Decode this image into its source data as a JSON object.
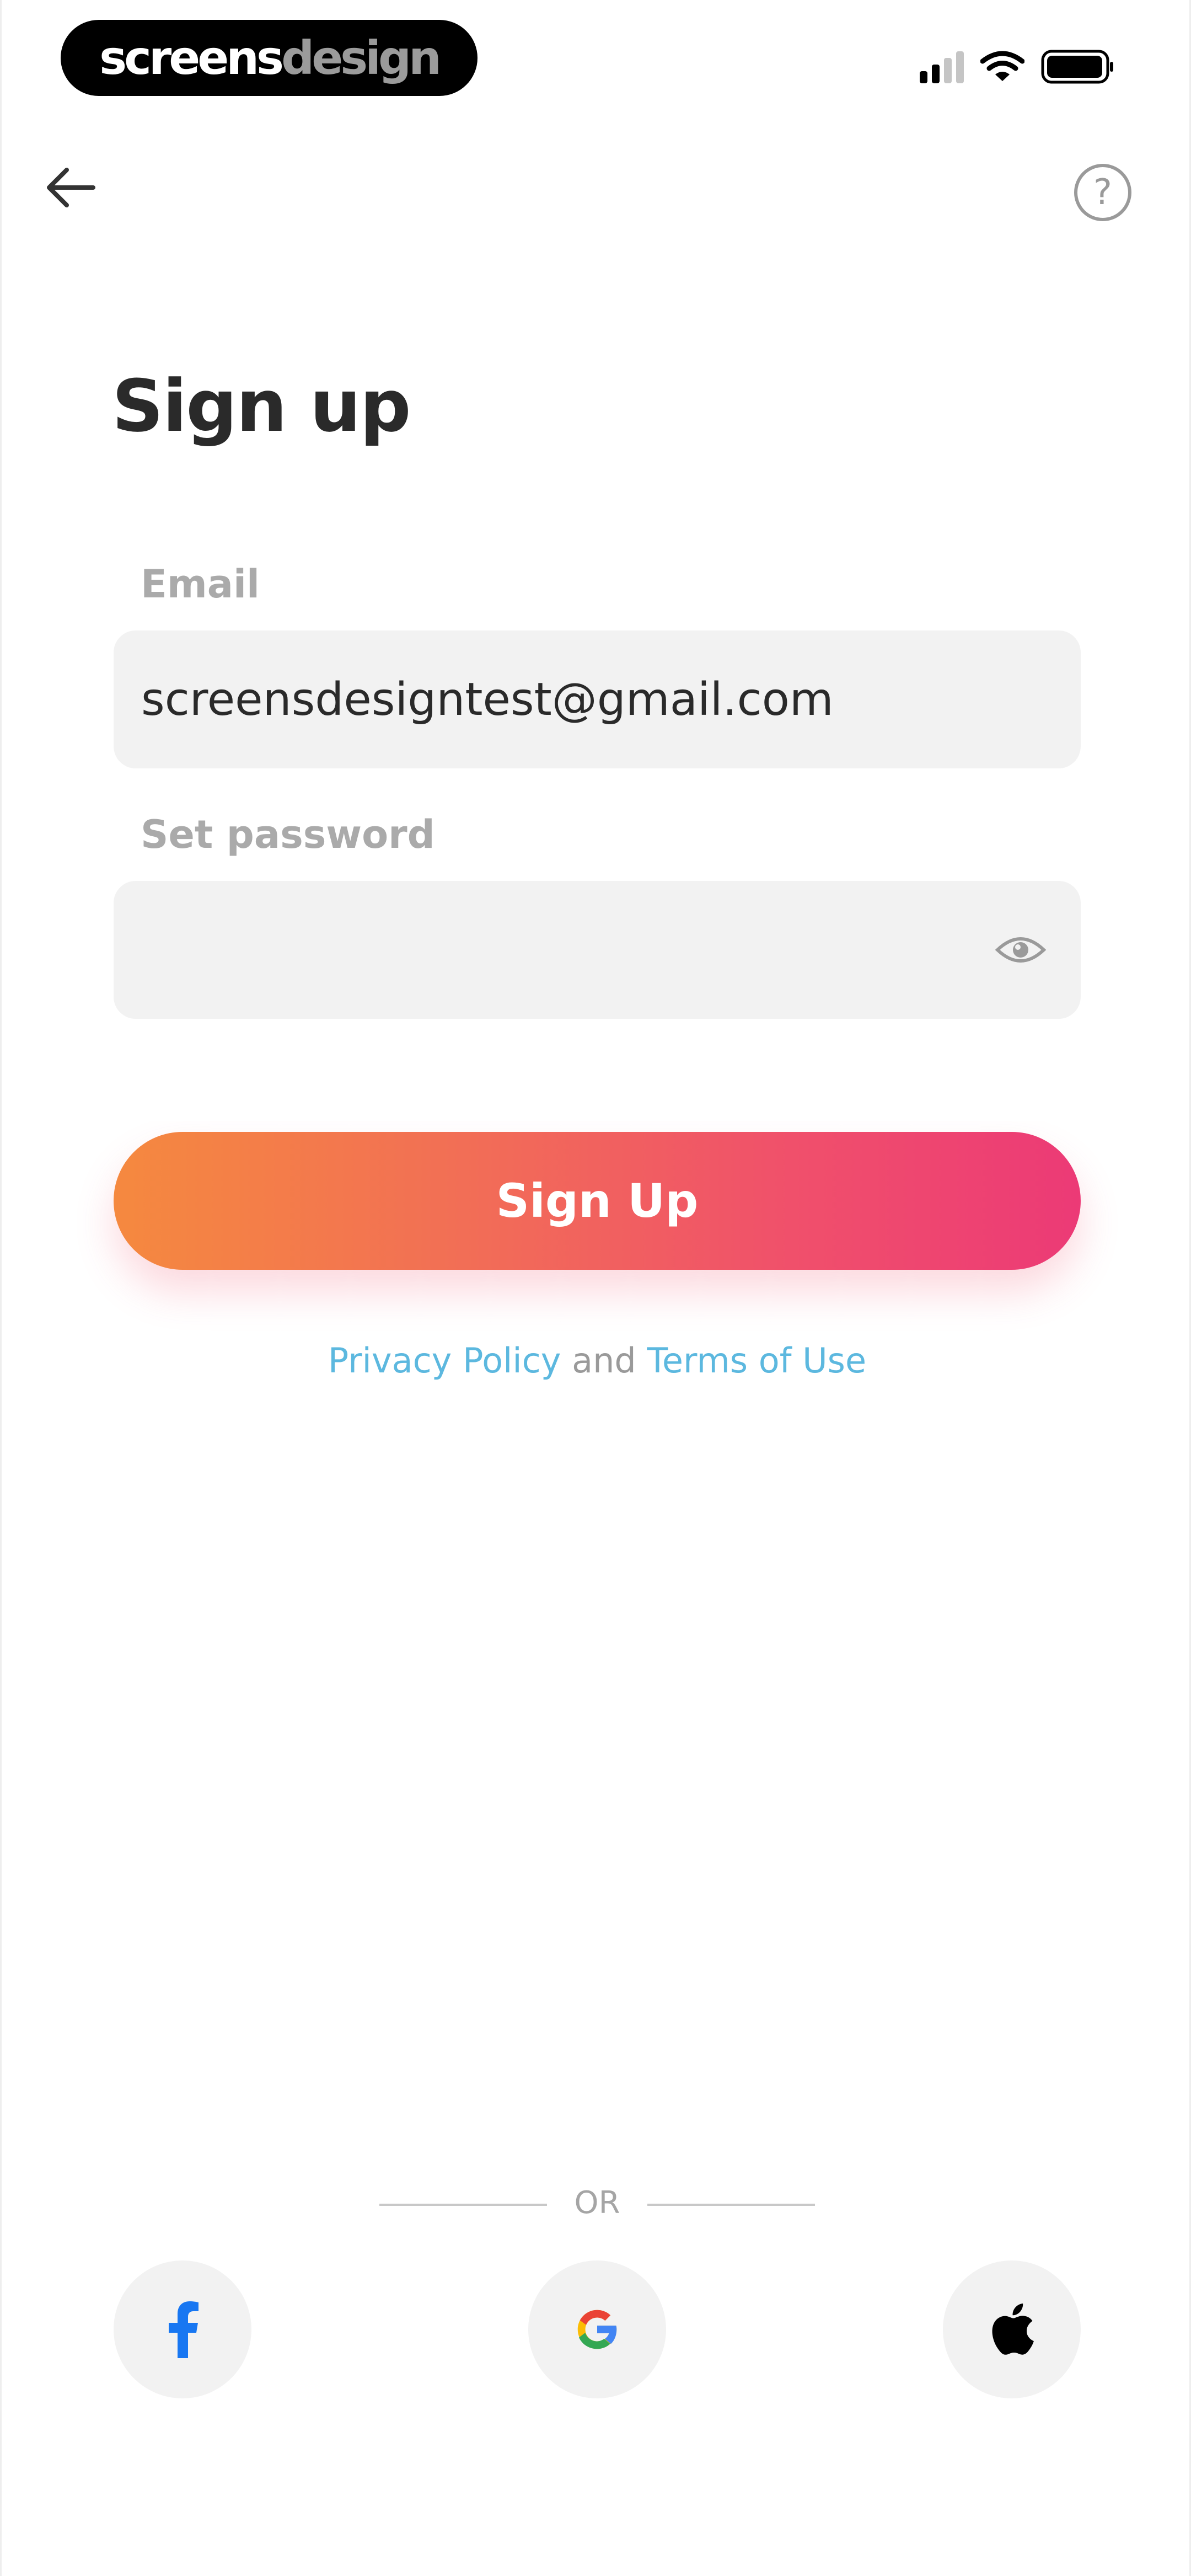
{
  "status_bar": {
    "brand_part1": "screens",
    "brand_part2": "design",
    "signal_icon": "cellular-signal-icon",
    "wifi_icon": "wifi-icon",
    "battery_icon": "battery-icon"
  },
  "nav": {
    "back_icon": "arrow-left-icon",
    "help_label": "?",
    "help_icon": "question-circle-icon"
  },
  "title": "Sign up",
  "form": {
    "email_label": "Email",
    "email_value": "screensdesigntest@gmail.com",
    "password_label": "Set password",
    "password_value": "",
    "password_toggle_icon": "eye-icon",
    "submit_label": "Sign Up"
  },
  "legal": {
    "privacy_label": "Privacy Policy",
    "conjunction": "and",
    "terms_label": "Terms of Use"
  },
  "divider_label": "OR",
  "social": [
    {
      "name": "facebook",
      "icon": "facebook-icon"
    },
    {
      "name": "google",
      "icon": "google-icon"
    },
    {
      "name": "apple",
      "icon": "apple-icon"
    }
  ],
  "colors": {
    "gradient_start": "#f5893f",
    "gradient_end": "#ec3a76",
    "link": "#5cb8df",
    "field_bg": "#f2f2f2",
    "title": "#2a2a2a",
    "label": "#aaaaaa"
  }
}
